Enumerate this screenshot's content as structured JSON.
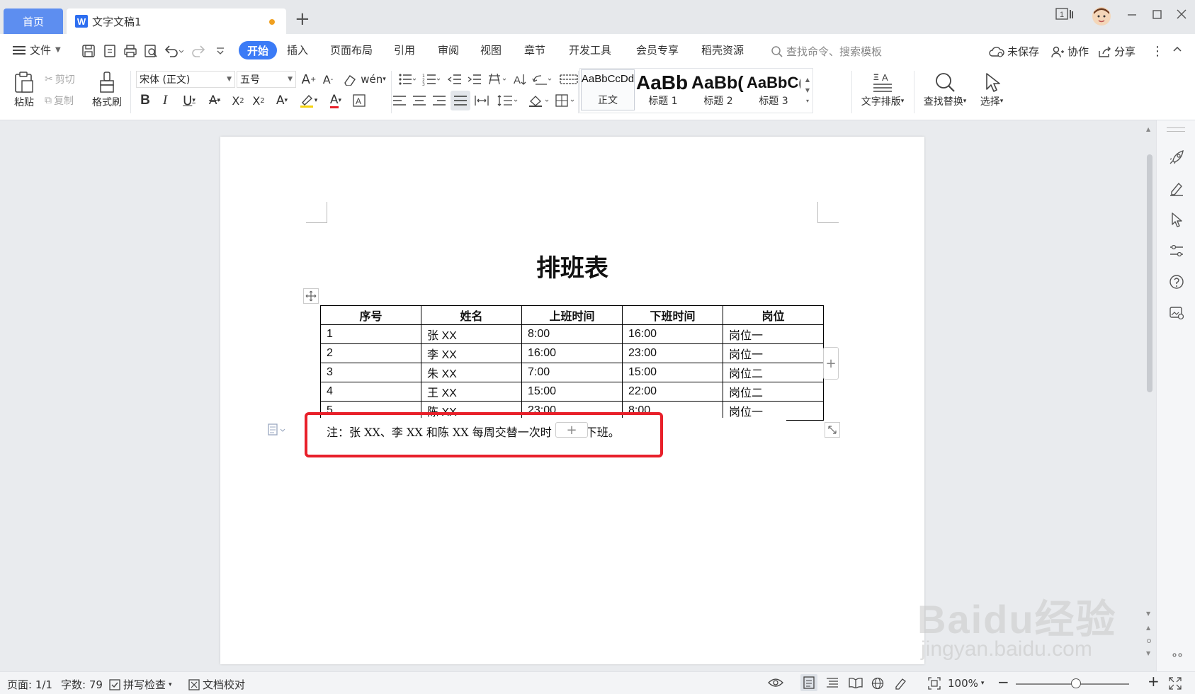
{
  "tabs": {
    "home": "首页",
    "document": "文字文稿1",
    "new_tab": "+"
  },
  "window_controls": {
    "counter": "1"
  },
  "menu": {
    "file": "文件",
    "items": [
      "开始",
      "插入",
      "页面布局",
      "引用",
      "审阅",
      "视图",
      "章节",
      "开发工具",
      "会员专享",
      "稻壳资源"
    ],
    "active": "开始",
    "search_placeholder": "查找命令、搜索模板",
    "unsaved": "未保存",
    "collaborate": "协作",
    "share": "分享"
  },
  "ribbon": {
    "paste": "粘贴",
    "cut": "剪切",
    "copy": "复制",
    "format_painter": "格式刷",
    "font_name": "宋体 (正文)",
    "font_size": "五号",
    "styles": [
      {
        "sample": "AaBbCcDd",
        "name": "正文"
      },
      {
        "sample": "AaBb",
        "name": "标题 1"
      },
      {
        "sample": "AaBb(",
        "name": "标题 2"
      },
      {
        "sample": "AaBbC(",
        "name": "标题 3"
      }
    ],
    "text_layout": "文字排版",
    "find_replace": "查找替换",
    "select": "选择"
  },
  "document": {
    "title": "排班表",
    "table": {
      "headers": [
        "序号",
        "姓名",
        "上班时间",
        "下班时间",
        "岗位"
      ],
      "rows": [
        [
          "1",
          "张 XX",
          "8:00",
          "16:00",
          "岗位一"
        ],
        [
          "2",
          "李 XX",
          "16:00",
          "23:00",
          "岗位一"
        ],
        [
          "3",
          "朱 XX",
          "7:00",
          "15:00",
          "岗位二"
        ],
        [
          "4",
          "王 XX",
          "15:00",
          "22:00",
          "岗位二"
        ],
        [
          "5",
          "陈 XX",
          "23:00",
          "8:00",
          "岗位一"
        ]
      ]
    },
    "note_before": "注：张 XX、李 XX 和陈 XX 每周交替一次时",
    "note_after": "下班。"
  },
  "statusbar": {
    "page": "页面: 1/1",
    "word_count": "字数: 79",
    "spell_check": "拼写检查",
    "proofread": "文档校对",
    "zoom": "100%"
  },
  "watermark": {
    "brand": "Baidu经验",
    "url": "jingyan.baidu.com"
  },
  "colors": {
    "accent": "#3b7bf6",
    "home_tab": "#5d8ef0",
    "highlight_box": "#e8202a"
  }
}
